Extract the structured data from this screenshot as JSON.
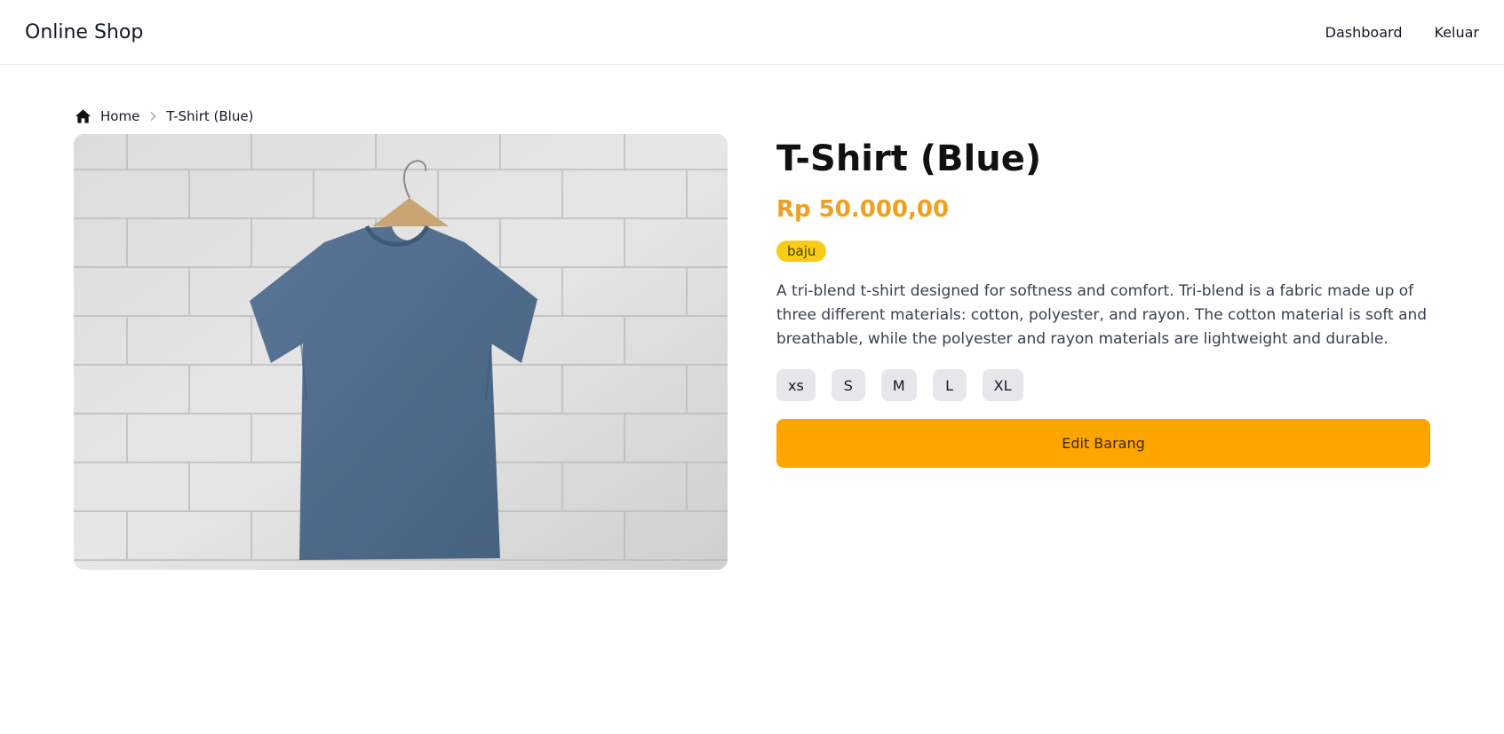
{
  "navbar": {
    "brand": "Online Shop",
    "links": [
      "Dashboard",
      "Keluar"
    ]
  },
  "breadcrumb": {
    "home_icon": "home-icon",
    "home": "Home",
    "separator_icon": "chevron-right-icon",
    "current": "T-Shirt (Blue)"
  },
  "product": {
    "image_alt": "T-Shirt (Blue)",
    "title": "T-Shirt (Blue)",
    "price": "Rp 50.000,00",
    "category": "baju",
    "description": "A tri-blend t-shirt designed for softness and comfort. Tri-blend is a fabric made up of three different materials: cotton, polyester, and rayon. The cotton material is soft and breathable, while the polyester and rayon materials are lightweight and durable.",
    "sizes": [
      "xs",
      "S",
      "M",
      "L",
      "XL"
    ],
    "edit_label": "Edit Barang"
  },
  "colors": {
    "price": "#f0a020",
    "badge": "#facc15",
    "primary_button": "#ffa500",
    "size_button": "#e5e7eb"
  }
}
